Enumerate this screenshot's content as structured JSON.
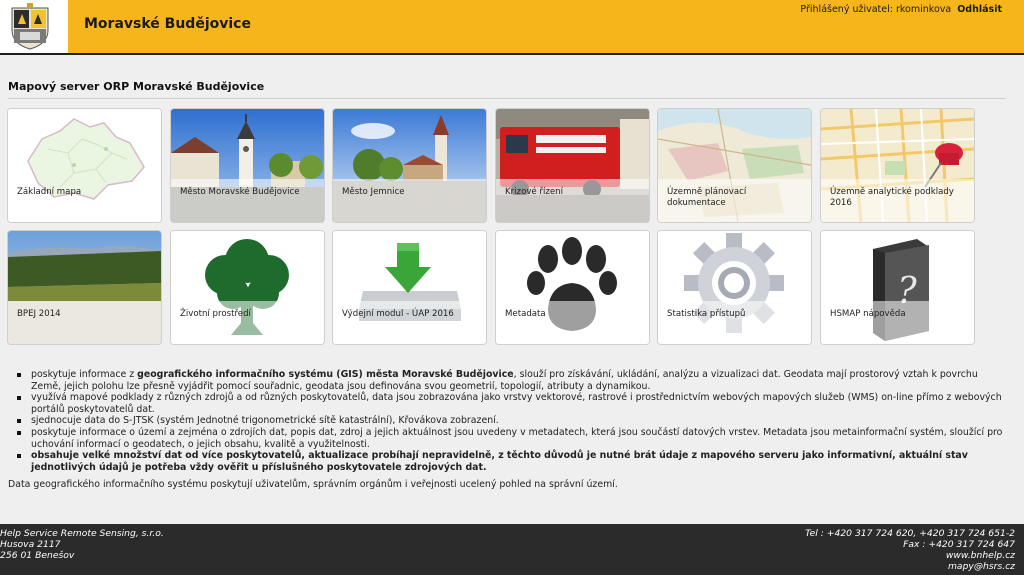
{
  "header": {
    "town": "Moravské Budějovice",
    "user_label": "Přihlášený uživatel: rkominkova",
    "logout": "Odhlásit"
  },
  "page": {
    "heading": "Mapový server ORP Moravské Budějovice"
  },
  "tiles": [
    {
      "label": "Základní mapa"
    },
    {
      "label": "Město Moravské Budějovice"
    },
    {
      "label": "Město Jemnice"
    },
    {
      "label": "Krizové řízení"
    },
    {
      "label": "Územně plánovací dokumentace"
    },
    {
      "label": "Územně analytické podklady 2016"
    },
    {
      "label": "BPEJ 2014"
    },
    {
      "label": "Životní prostředí"
    },
    {
      "label": "Výdejní modul - ÚAP 2016"
    },
    {
      "label": "Metadata"
    },
    {
      "label": "Statistika přístupů"
    },
    {
      "label": "HSMAP nápověda"
    }
  ],
  "info": {
    "b1_pre": "poskytuje informace z ",
    "b1_bold": "geografického informačního systému (GIS) města Moravské Budějovice",
    "b1_post": ", slouží pro získávání, ukládání, analýzu a vizualizaci dat. Geodata mají prostorový vztah k povrchu Země, jejich polohu lze přesně vyjádřit pomocí souřadnic, geodata jsou definována svou geometrií, topologií, atributy a dynamikou.",
    "b2": "využívá mapové podklady z různých zdrojů a od různých poskytovatelů, data jsou zobrazována jako vrstvy vektorové, rastrové i prostřednictvím webových mapových služeb (WMS) on-line přímo z webových portálů poskytovatelů dat.",
    "b3": "sjednocuje data do S-JTSK (systém Jednotné trigonometrické sítě katastrální), Křovákova zobrazení.",
    "b4": "poskytuje informace o území a zejména o zdrojích dat, popis dat, zdroj a jejich aktuálnost jsou uvedeny v metadatech, která jsou součástí datových vrstev. Metadata jsou metainformační systém, sloužící pro uchování informací o geodatech, o jejich obsahu, kvalitě a využitelnosti.",
    "b5": "obsahuje velké množství dat od více poskytovatelů, aktualizace probíhají nepravidelně, z těchto důvodů je nutné brát údaje z mapového serveru jako informativní, aktuální stav jednotlivých údajů je potřeba vždy ověřit u příslušného poskytovatele zdrojových dat.",
    "summary": "Data geografického informačního systému poskytují uživatelům, správním orgánům i veřejnosti ucelený pohled na správní území."
  },
  "footer": {
    "company": "Help Service Remote Sensing, s.r.o.",
    "street": "Husova 2117",
    "city": "256 01 Benešov",
    "tel": "Tel : +420 317 724 620, +420 317 724 651-2",
    "fax": "Fax : +420 317 724 647",
    "web": "www.bnhelp.cz",
    "email": "mapy@hsrs.cz"
  },
  "colors": {
    "header": "#f6b51b",
    "footer": "#2b2b2b",
    "background": "#efefef"
  }
}
